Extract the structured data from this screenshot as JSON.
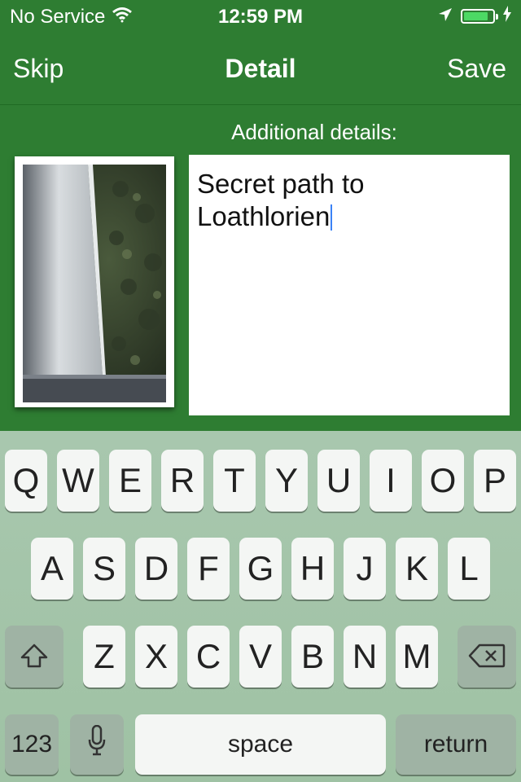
{
  "status_bar": {
    "carrier": "No Service",
    "time": "12:59 PM",
    "battery_level": 0.85,
    "icons": [
      "wifi-icon",
      "location-arrow-icon",
      "battery-icon",
      "charging-bolt-icon"
    ]
  },
  "nav": {
    "left_label": "Skip",
    "title": "Detail",
    "right_label": "Save"
  },
  "content": {
    "details_label": "Additional details:",
    "details_text": "Secret path to Loathlorien"
  },
  "keyboard": {
    "row1": [
      "Q",
      "W",
      "E",
      "R",
      "T",
      "Y",
      "U",
      "I",
      "O",
      "P"
    ],
    "row2": [
      "A",
      "S",
      "D",
      "F",
      "G",
      "H",
      "J",
      "K",
      "L"
    ],
    "row3": [
      "Z",
      "X",
      "C",
      "V",
      "B",
      "N",
      "M"
    ],
    "numbers_label": "123",
    "space_label": "space",
    "return_label": "return"
  },
  "colors": {
    "theme_green": "#2e7d32",
    "keyboard_bg": "#a8c7ae",
    "battery_fill": "#4cd964"
  }
}
